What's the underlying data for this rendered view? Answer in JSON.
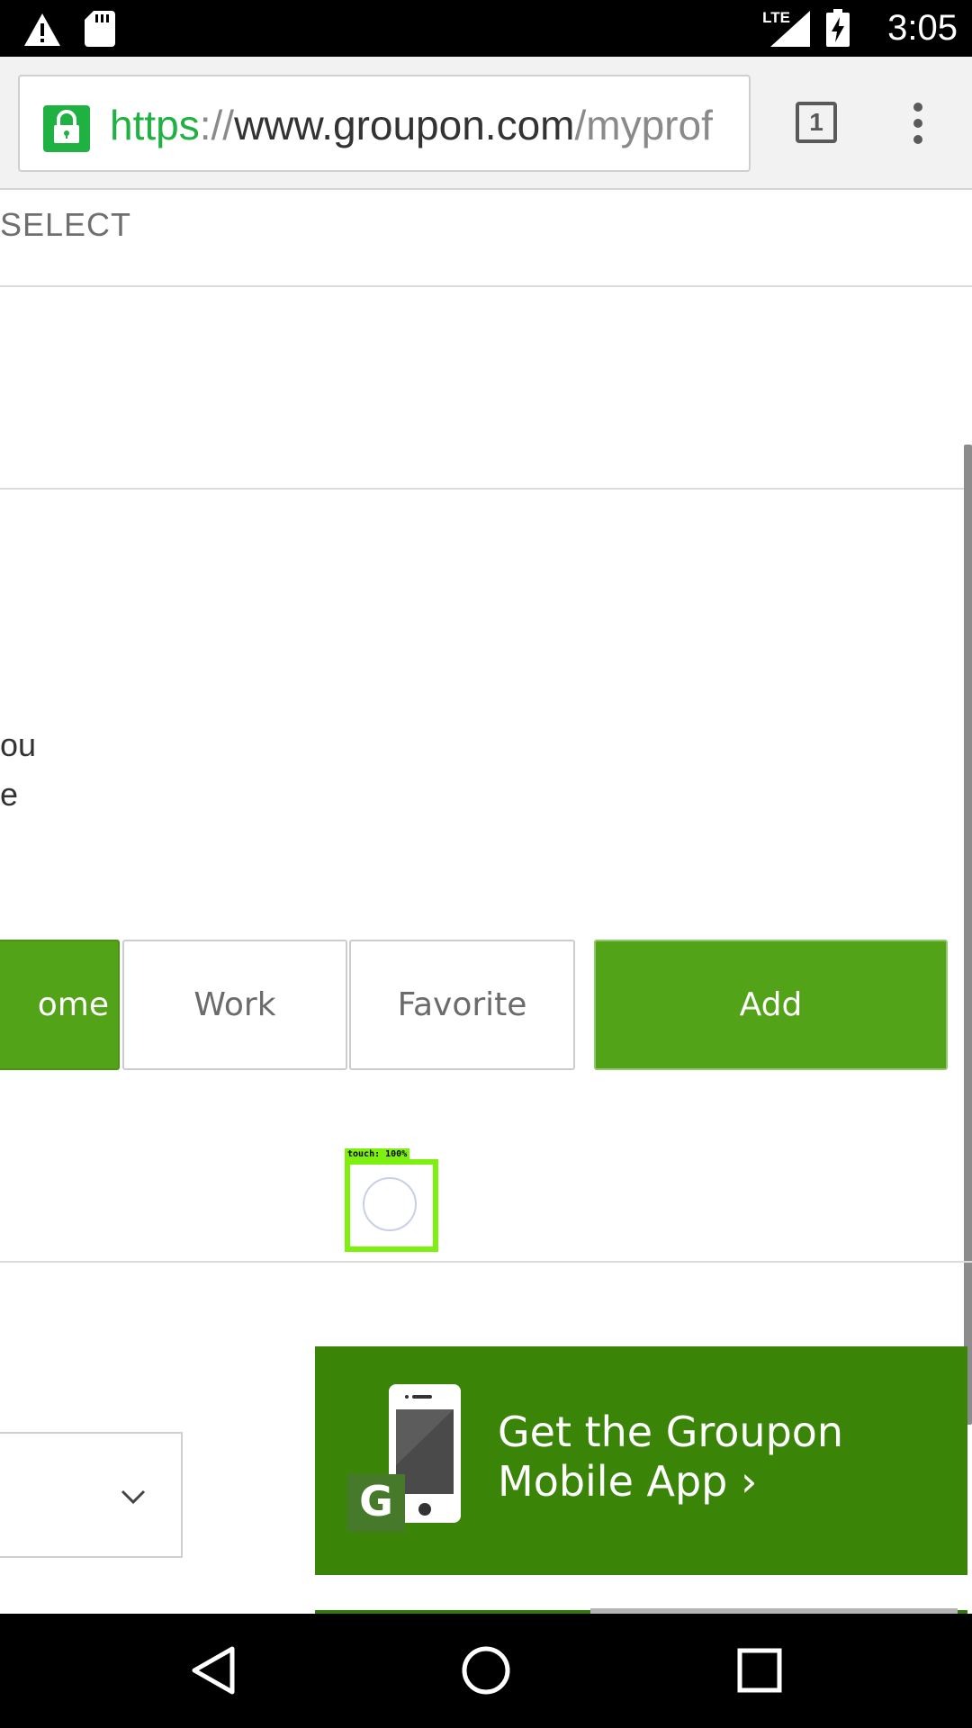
{
  "status_bar": {
    "time": "3:05",
    "network_label": "LTE",
    "icons": [
      "warning-icon",
      "sd-card-icon",
      "signal-icon",
      "battery-charging-icon"
    ]
  },
  "browser": {
    "url_scheme": "https",
    "url_separator": "://",
    "url_host": "www.groupon.com",
    "url_path": "/myprof",
    "tab_count": "1",
    "icons": [
      "lock-icon",
      "tab-switcher-icon",
      "overflow-menu-icon"
    ]
  },
  "page": {
    "select_label": "SELECT",
    "text_fragment_1": "ou",
    "text_fragment_2": "e",
    "address_type_options": {
      "home": "ome",
      "work": "Work",
      "favorite": "Favorite"
    },
    "add_button": "Add",
    "touch_indicator": "touch: 100%",
    "app_banner": {
      "line1": "Get the Groupon",
      "line2": "Mobile App ›",
      "logo_letter": "G"
    }
  },
  "colors": {
    "brand_green": "#53a318",
    "banner_green": "#3a8508",
    "lock_green": "#1fb141",
    "touch_highlight": "#7ef010"
  },
  "nav_bar": {
    "icons": [
      "back-icon",
      "home-icon",
      "recents-icon"
    ]
  }
}
